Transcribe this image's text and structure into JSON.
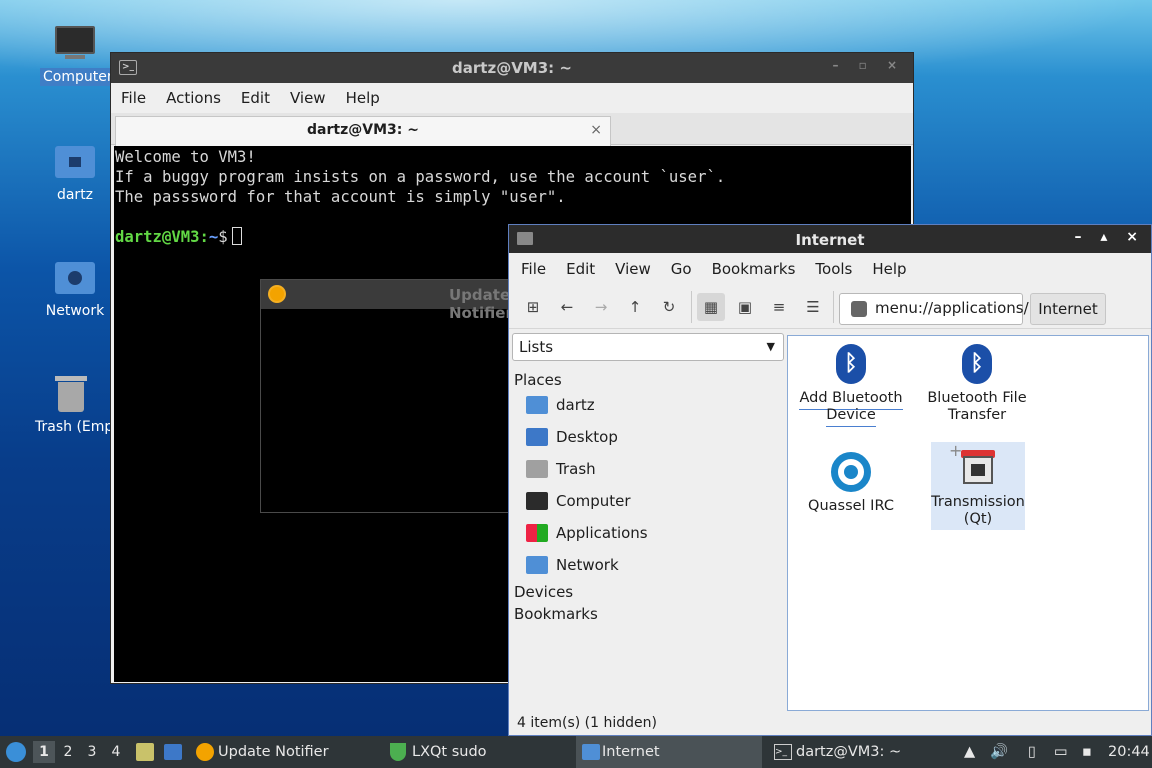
{
  "desktop": {
    "icons": [
      {
        "label": "Computer",
        "icon": "monitor-icon"
      },
      {
        "label": "dartz",
        "icon": "home-folder-icon"
      },
      {
        "label": "Network",
        "icon": "network-folder-icon"
      },
      {
        "label": "Trash (Empty)",
        "icon": "trash-icon"
      }
    ]
  },
  "terminal": {
    "title": "dartz@VM3: ~",
    "menu": [
      "File",
      "Actions",
      "Edit",
      "View",
      "Help"
    ],
    "tab_label": "dartz@VM3: ~",
    "tab_close": "×",
    "lines": [
      "Welcome to VM3!",
      "If a buggy program insists on a password, use the account `user`.",
      "The passsword for that account is simply \"user\"."
    ],
    "prompt_user": "dartz@VM3",
    "prompt_sep": ":",
    "prompt_path": "~",
    "prompt_sign": "$"
  },
  "update_window": {
    "title": "Update Notifier"
  },
  "file_manager": {
    "title": "Internet",
    "menu": [
      "File",
      "Edit",
      "View",
      "Go",
      "Bookmarks",
      "Tools",
      "Help"
    ],
    "address": "menu://applications/",
    "breadcrumb": "Internet",
    "side_mode": "Lists",
    "places_heading": "Places",
    "places": [
      "dartz",
      "Desktop",
      "Trash",
      "Computer",
      "Applications",
      "Network"
    ],
    "devices_heading": "Devices",
    "bookmarks_heading": "Bookmarks",
    "apps": [
      {
        "label": "Add Bluetooth Device",
        "icon": "bluetooth-icon"
      },
      {
        "label": "Bluetooth File Transfer",
        "icon": "bluetooth-icon"
      },
      {
        "label": "Quassel IRC",
        "icon": "quassel-icon"
      },
      {
        "label": "Transmission (Qt)",
        "icon": "transmission-icon"
      }
    ],
    "status": "4 item(s) (1 hidden)"
  },
  "taskbar": {
    "desktops": [
      "1",
      "2",
      "3",
      "4"
    ],
    "tasks": [
      "Update Notifier",
      "LXQt sudo",
      "Internet",
      "dartz@VM3: ~"
    ],
    "clock": "20:44"
  },
  "colors": {
    "accent": "#3f7ec6",
    "terminal_bg": "#000000",
    "taskbar_bg": "#2e3538"
  }
}
